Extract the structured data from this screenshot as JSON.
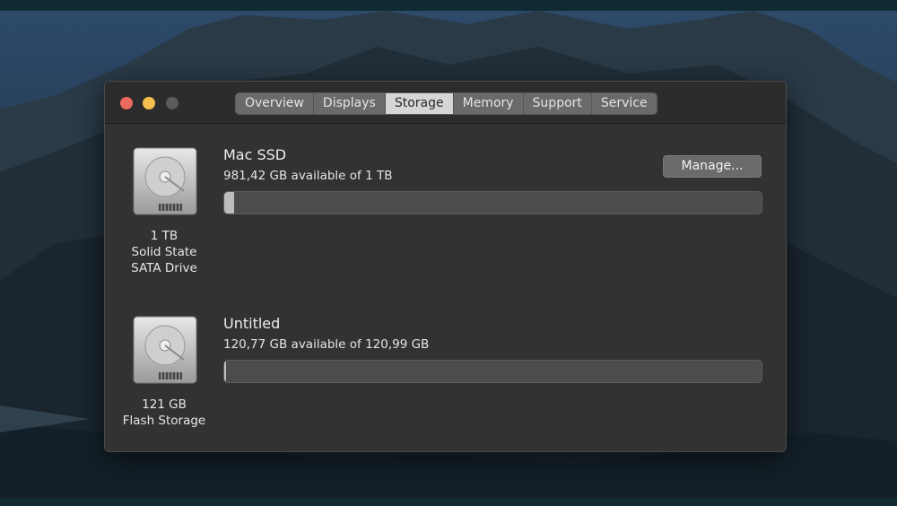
{
  "window": {
    "traffic_lights": [
      "close",
      "minimize",
      "zoom"
    ],
    "tabs": [
      {
        "label": "Overview"
      },
      {
        "label": "Displays"
      },
      {
        "label": "Storage",
        "active": true
      },
      {
        "label": "Memory"
      },
      {
        "label": "Support"
      },
      {
        "label": "Service"
      }
    ]
  },
  "drives": [
    {
      "icon": "hard-drive-icon",
      "label_lines": [
        "1 TB",
        "Solid State",
        "SATA Drive"
      ],
      "volume_name": "Mac SSD",
      "availability": "981,42 GB available of 1 TB",
      "used_fraction": 0.018
    },
    {
      "icon": "hard-drive-icon",
      "label_lines": [
        "121 GB",
        "Flash Storage"
      ],
      "volume_name": "Untitled",
      "availability": "120,77 GB available of 120,99 GB",
      "used_fraction": 0.002
    }
  ],
  "manage_button": {
    "label": "Manage..."
  },
  "colors": {
    "window_bg": "#323232",
    "tab_active": "#d6d6d6",
    "bar_fill": "#bdbdbd"
  }
}
